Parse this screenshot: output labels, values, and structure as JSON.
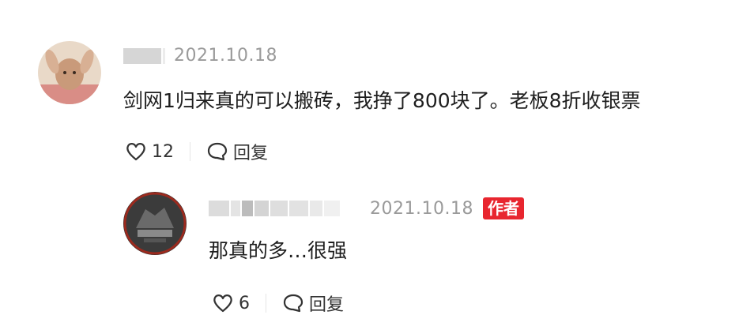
{
  "comment": {
    "date": "2021.10.18",
    "text": "剑网1归来真的可以搬砖，我挣了800块了。老板8折收银票",
    "like_count": "12",
    "reply_label": "回复",
    "icons": {
      "like": "heart-icon",
      "reply": "chat-bubble-icon"
    }
  },
  "reply": {
    "date": "2021.10.18",
    "badge": "作者",
    "text": "那真的多…很强",
    "like_count": "6",
    "reply_label": "回复",
    "badge_color": "#e8262f"
  }
}
